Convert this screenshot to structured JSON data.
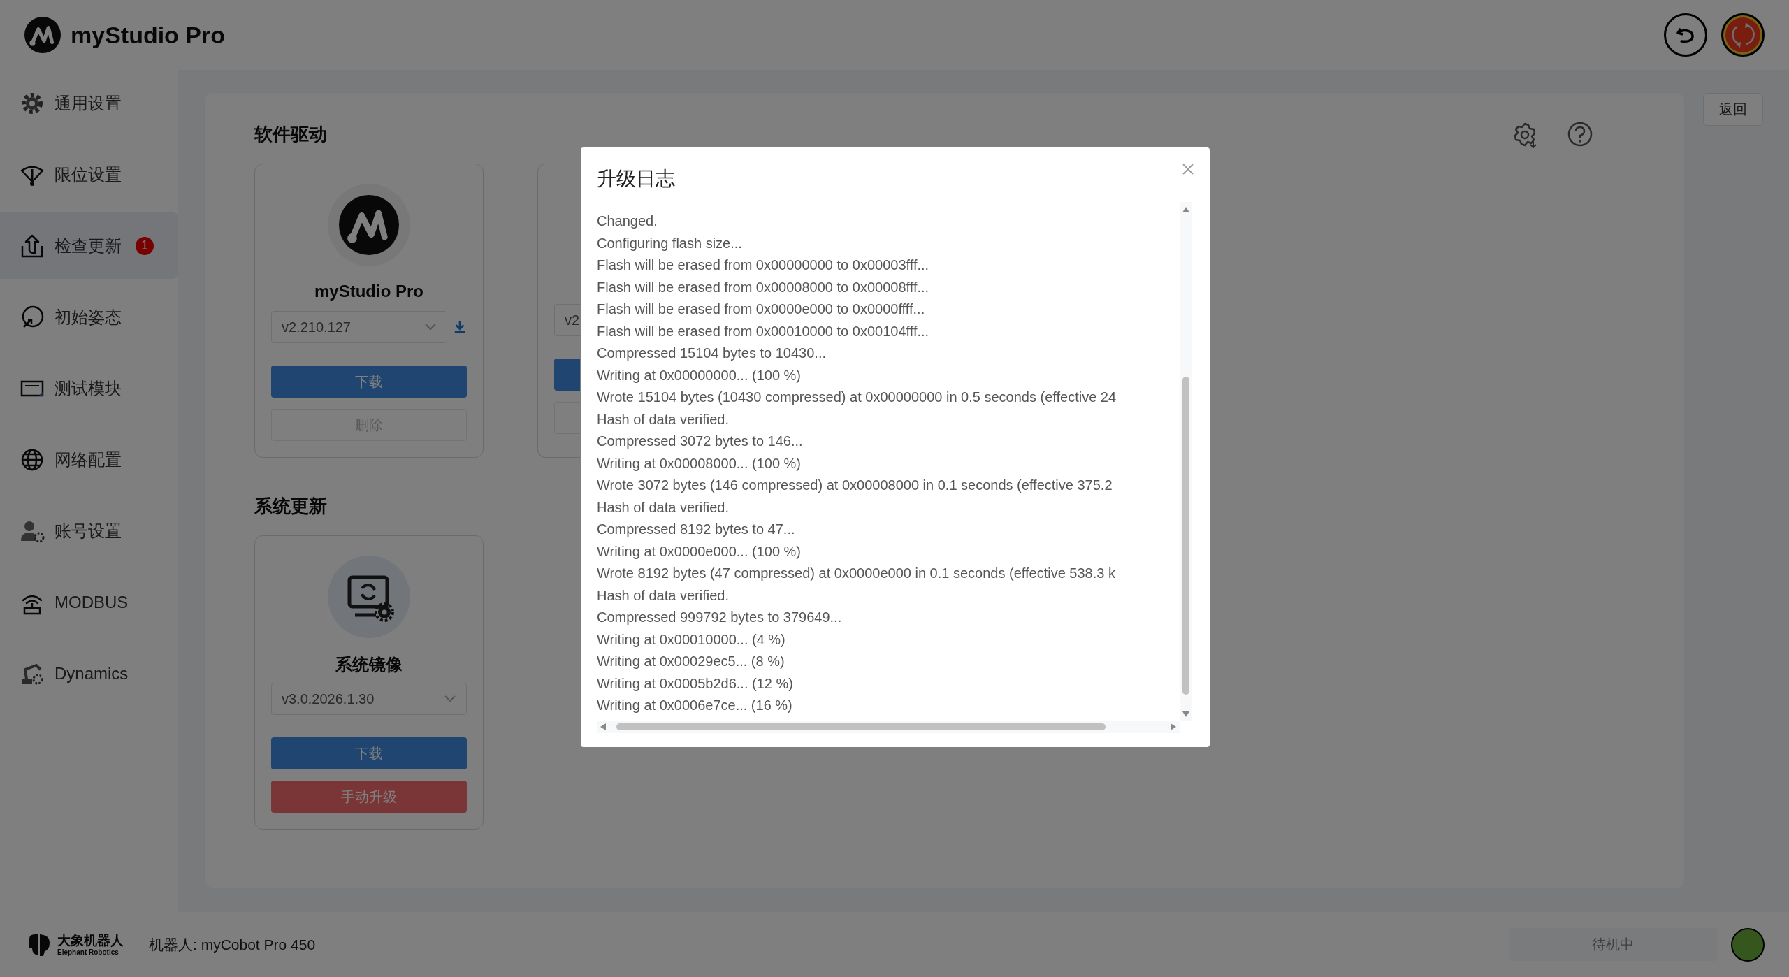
{
  "header": {
    "title": "myStudio Pro"
  },
  "sidebar": {
    "items": [
      {
        "label": "通用设置",
        "selected": false
      },
      {
        "label": "限位设置",
        "selected": false
      },
      {
        "label": "检查更新",
        "selected": true,
        "badge": "1"
      },
      {
        "label": "初始姿态",
        "selected": false
      },
      {
        "label": "测试模块",
        "selected": false
      },
      {
        "label": "网络配置",
        "selected": false
      },
      {
        "label": "账号设置",
        "selected": false
      },
      {
        "label": "MODBUS",
        "selected": false
      },
      {
        "label": "Dynamics",
        "selected": false
      }
    ]
  },
  "back_button": "返回",
  "sections": [
    {
      "title": "软件驱动",
      "cards": [
        {
          "kind": "app",
          "title": "myStudio Pro",
          "version": "v2.210.127",
          "buttons": [
            {
              "kind": "primary",
              "label": "下载"
            },
            {
              "kind": "disabled",
              "label": "删除"
            }
          ]
        },
        {
          "kind": "partial",
          "version": "v2",
          "buttons": [
            {
              "kind": "primary"
            },
            {
              "kind": "disabled"
            }
          ]
        }
      ]
    },
    {
      "title": "系统更新",
      "cards": [
        {
          "kind": "system",
          "title": "系统镜像",
          "version": "v3.0.2026.1.30",
          "buttons": [
            {
              "kind": "primary",
              "label": "下载"
            },
            {
              "kind": "danger",
              "label": "手动升级"
            }
          ]
        }
      ]
    }
  ],
  "dialog": {
    "title": "升级日志",
    "lines": [
      "Changed.",
      "Configuring flash size...",
      "Flash will be erased from 0x00000000 to 0x00003fff...",
      "Flash will be erased from 0x00008000 to 0x00008fff...",
      "Flash will be erased from 0x0000e000 to 0x0000ffff...",
      "Flash will be erased from 0x00010000 to 0x00104fff...",
      "Compressed 15104 bytes to 10430...",
      "Writing at 0x00000000... (100 %)",
      "Wrote 15104 bytes (10430 compressed) at 0x00000000 in 0.5 seconds (effective 24",
      "Hash of data verified.",
      "Compressed 3072 bytes to 146...",
      "Writing at 0x00008000... (100 %)",
      "Wrote 3072 bytes (146 compressed) at 0x00008000 in 0.1 seconds (effective 375.2",
      "Hash of data verified.",
      "Compressed 8192 bytes to 47...",
      "Writing at 0x0000e000... (100 %)",
      "Wrote 8192 bytes (47 compressed) at 0x0000e000 in 0.1 seconds (effective 538.3 k",
      "Hash of data verified.",
      "Compressed 999792 bytes to 379649...",
      "Writing at 0x00010000... (4 %)",
      "Writing at 0x00029ec5... (8 %)",
      "Writing at 0x0005b2d6... (12 %)",
      "Writing at 0x0006e7ce... (16 %)"
    ]
  },
  "footer": {
    "brand": "大象机器人",
    "brand_sub": "Elephant Robotics",
    "robot": "机器人: myCobot Pro 450",
    "status_button": "待机中"
  }
}
